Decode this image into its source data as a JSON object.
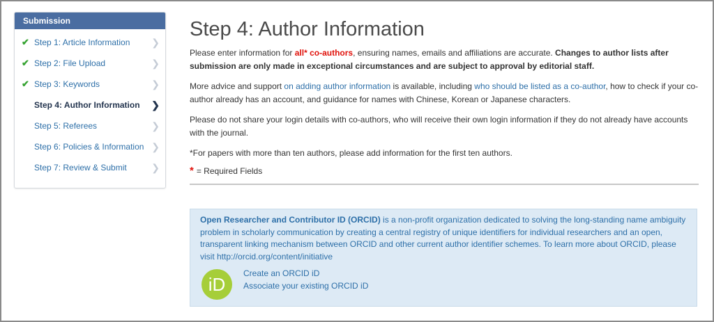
{
  "sidebar": {
    "header": "Submission",
    "items": [
      {
        "label": "Step 1: Article Information",
        "done": true,
        "active": false
      },
      {
        "label": "Step 2: File Upload",
        "done": true,
        "active": false
      },
      {
        "label": "Step 3: Keywords",
        "done": true,
        "active": false
      },
      {
        "label": "Step 4: Author Information",
        "done": false,
        "active": true
      },
      {
        "label": "Step 5: Referees",
        "done": false,
        "active": false
      },
      {
        "label": "Step 6: Policies & Information",
        "done": false,
        "active": false
      },
      {
        "label": "Step 7: Review & Submit",
        "done": false,
        "active": false
      }
    ],
    "check_icon": "check-icon",
    "chevron_icon": "chevron-right-icon"
  },
  "main": {
    "title": "Step 4: Author Information",
    "p1": {
      "a": "Please enter information for ",
      "red": "all* co-authors",
      "b": ", ensuring names, emails and affiliations are accurate. ",
      "bold": "Changes to author lists after submission are only made in exceptional circumstances and are subject to approval by editorial staff."
    },
    "p2": {
      "a": "More advice and support ",
      "link1": "on adding author information",
      "b": " is available, including ",
      "link2": "who should be listed as a co-author",
      "c": ", how to check if your co-author already has an account, and guidance for names with Chinese, Korean or Japanese characters."
    },
    "p3": "Please do not share your login details with co-authors, who will receive their own login information if they do not already have accounts with the journal.",
    "p4": "*For papers with more than ten authors, please add information for the first ten authors.",
    "required": {
      "star": "*",
      "text": "= Required Fields"
    }
  },
  "orcid": {
    "bold": "Open Researcher and Contributor ID (ORCID)",
    "text": " is a non-profit organization dedicated to solving the long-standing name ambiguity problem in scholarly communication by creating a central registry of unique identifiers for individual researchers and an open, transparent linking mechanism between ORCID and other current author identifier schemes. To learn more about ORCID, please visit http://orcid.org/content/initiative",
    "logo_text": "iD",
    "create": "Create an ORCID iD",
    "associate": "Associate your existing ORCID iD"
  },
  "colors": {
    "sidebar_header": "#4a6da1",
    "link": "#2d6fa8",
    "required_red": "#e0120b",
    "check_green": "#36a332",
    "orcid_green": "#a6ce39",
    "orcid_box": "#ddeaf5"
  }
}
